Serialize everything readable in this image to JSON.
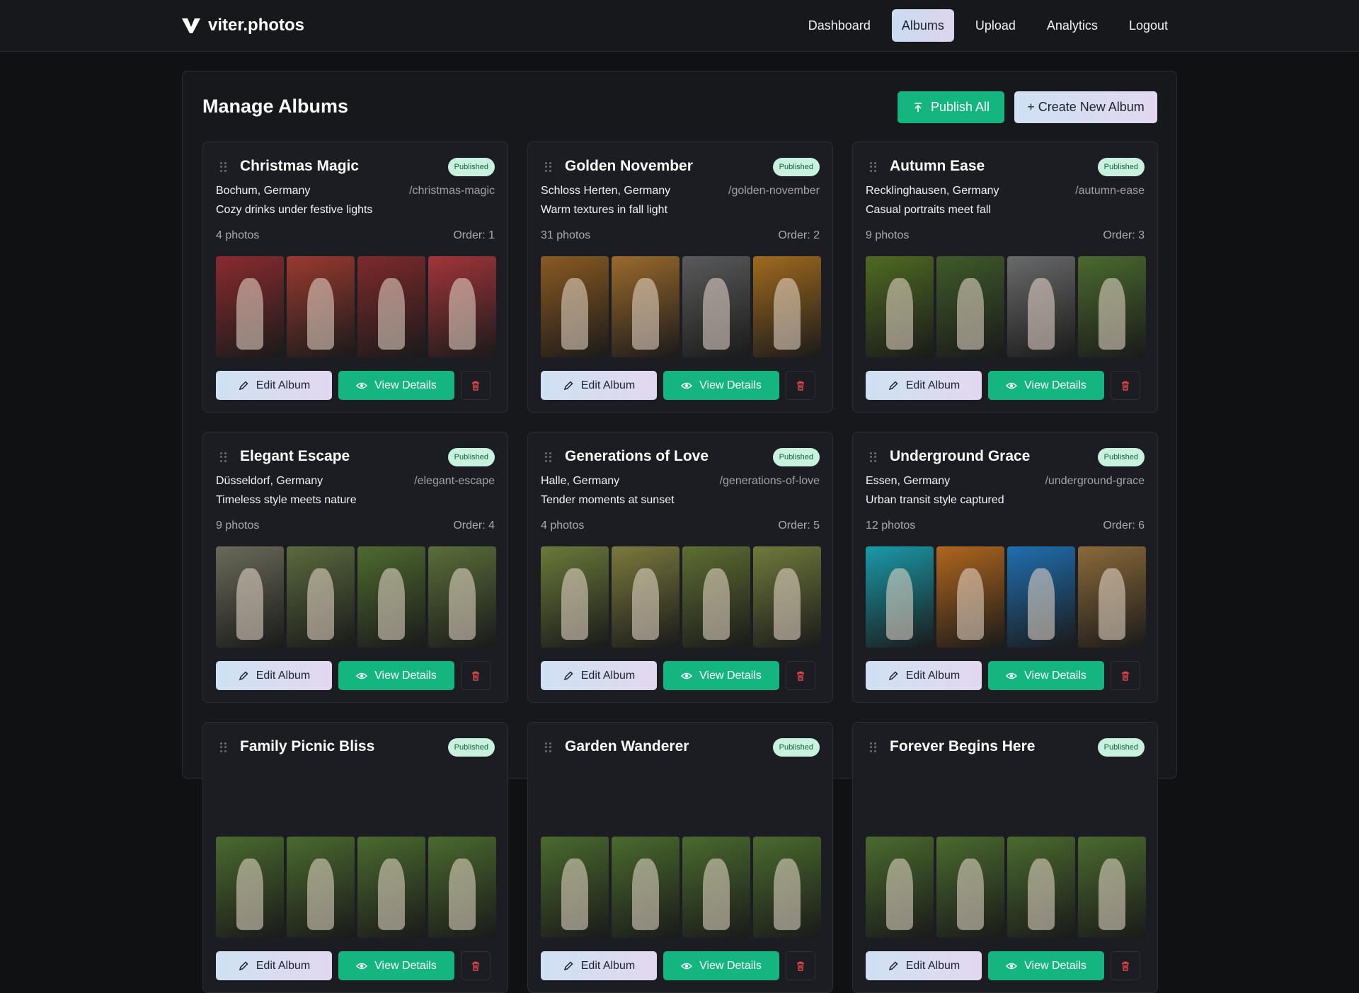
{
  "brand": {
    "name": "viter.photos"
  },
  "nav": [
    {
      "label": "Dashboard",
      "active": false
    },
    {
      "label": "Albums",
      "active": true
    },
    {
      "label": "Upload",
      "active": false
    },
    {
      "label": "Analytics",
      "active": false
    },
    {
      "label": "Logout",
      "active": false
    }
  ],
  "page": {
    "title": "Manage Albums",
    "publish_all_label": "Publish All",
    "create_label": "+ Create New Album"
  },
  "card_actions": {
    "edit_label": "Edit Album",
    "view_label": "View Details"
  },
  "albums": [
    {
      "title": "Christmas Magic",
      "status": "Published",
      "location": "Bochum, Germany",
      "slug": "/christmas-magic",
      "description": "Cozy drinks under festive lights",
      "photos": "4 photos",
      "order": "Order: 1",
      "thumb_colors": [
        "#8a2b2f",
        "#9a3a30",
        "#7d2a2c",
        "#a2353a"
      ]
    },
    {
      "title": "Golden November",
      "status": "Published",
      "location": "Schloss Herten, Germany",
      "slug": "/golden-november",
      "description": "Warm textures in fall light",
      "photos": "31 photos",
      "order": "Order: 2",
      "thumb_colors": [
        "#8a5a22",
        "#9b6a2c",
        "#5a5a5a",
        "#a06a1e"
      ]
    },
    {
      "title": "Autumn Ease",
      "status": "Published",
      "location": "Recklinghausen, Germany",
      "slug": "/autumn-ease",
      "description": "Casual portraits meet fall",
      "photos": "9 photos",
      "order": "Order: 3",
      "thumb_colors": [
        "#4f6a22",
        "#3f5a2a",
        "#6a6a6a",
        "#4a6a2e"
      ]
    },
    {
      "title": "Elegant Escape",
      "status": "Published",
      "location": "Düsseldorf, Germany",
      "slug": "/elegant-escape",
      "description": "Timeless style meets nature",
      "photos": "9 photos",
      "order": "Order: 4",
      "thumb_colors": [
        "#6a6a5a",
        "#5a6a3e",
        "#4e6a30",
        "#5a6e3a"
      ]
    },
    {
      "title": "Generations of Love",
      "status": "Published",
      "location": "Halle, Germany",
      "slug": "/generations-of-love",
      "description": "Tender moments at sunset",
      "photos": "4 photos",
      "order": "Order: 5",
      "thumb_colors": [
        "#6a7a3a",
        "#7a7a3e",
        "#5e6e32",
        "#707a3c"
      ]
    },
    {
      "title": "Underground Grace",
      "status": "Published",
      "location": "Essen, Germany",
      "slug": "/underground-grace",
      "description": "Urban transit style captured",
      "photos": "12 photos",
      "order": "Order: 6",
      "thumb_colors": [
        "#1a9aa8",
        "#b0661e",
        "#1f6fb0",
        "#8a6a3a"
      ]
    },
    {
      "title": "Family Picnic Bliss",
      "status": "Published",
      "location": "",
      "slug": "",
      "description": "",
      "photos": "",
      "order": "",
      "thumb_colors": [
        "#4a6a2e",
        "#4a6a2e",
        "#4a6a2e",
        "#4a6a2e"
      ]
    },
    {
      "title": "Garden Wanderer",
      "status": "Published",
      "location": "",
      "slug": "",
      "description": "",
      "photos": "",
      "order": "",
      "thumb_colors": [
        "#4a6a2e",
        "#4a6a2e",
        "#4a6a2e",
        "#4a6a2e"
      ]
    },
    {
      "title": "Forever Begins Here",
      "status": "Published",
      "location": "",
      "slug": "",
      "description": "",
      "photos": "",
      "order": "",
      "thumb_colors": [
        "#4a6a2e",
        "#4a6a2e",
        "#4a6a2e",
        "#4a6a2e"
      ]
    }
  ]
}
